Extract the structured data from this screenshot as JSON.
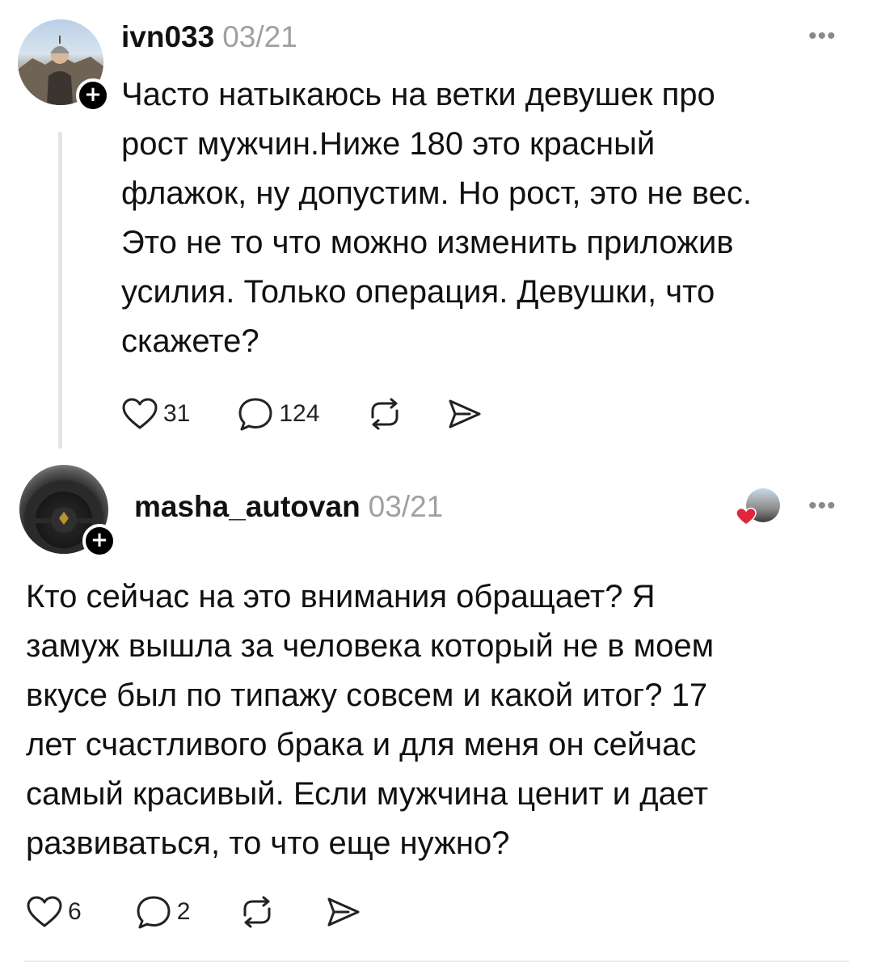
{
  "posts": [
    {
      "username": "ivn033",
      "date": "03/21",
      "text": "Часто натыкаюсь на ветки девушек про\nрост мужчин.Ниже 180 это красный\nфлажок, ну допустим. Но рост, это не вес.\nЭто не то что можно изменить приложив\nусилия. Только операция. Девушки, что\nскажете?",
      "likes": "31",
      "comments": "124"
    },
    {
      "username": "masha_autovan",
      "date": "03/21",
      "text": "Кто сейчас на это внимания обращает?  Я\nзамуж вышла за человека который не в моем\nвкусе был по типажу совсем и какой итог? 17\nлет счастливого брака и для меня он сейчас\nсамый красивый. Если мужчина ценит и дает\nразвиваться, то что еще нужно?",
      "likes": "6",
      "comments": "2"
    }
  ],
  "icons": {
    "more": "more-dots-icon",
    "like": "heart-icon",
    "comment": "comment-bubble-icon",
    "repost": "repost-icon",
    "share": "send-icon",
    "follow": "plus-icon",
    "liked_by_author": "heart-filled-icon"
  },
  "colors": {
    "date": "#a0a0a0",
    "heart_liked": "#e0263c",
    "thread_line": "#e4e4e4"
  }
}
